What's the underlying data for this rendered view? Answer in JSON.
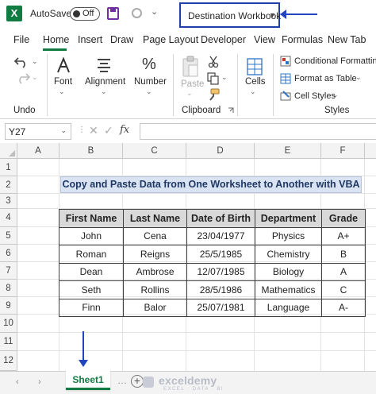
{
  "titlebar": {
    "logo_letter": "X",
    "autosave_label": "AutoSave",
    "autosave_state": "Off",
    "workbook_name": "Destination Workbook",
    "more_glyph": "⌄"
  },
  "menu_tabs": [
    "File",
    "Home",
    "Insert",
    "Draw",
    "Page Layout",
    "Developer",
    "View",
    "Formulas",
    "New Tab"
  ],
  "active_tab": "Home",
  "ribbon": {
    "undo_label": "Undo",
    "font_label": "Font",
    "alignment_label": "Alignment",
    "number_label": "Number",
    "paste_label": "Paste",
    "clipboard_label": "Clipboard",
    "cells_label": "Cells",
    "conditional_formatting": "Conditional Formatting",
    "format_as_table": "Format as Table",
    "cell_styles": "Cell Styles",
    "styles_label": "Styles",
    "dropdown_glyph": "⌄",
    "percent_glyph": "%"
  },
  "formula_bar": {
    "name_box": "Y27",
    "fx_label": "fx",
    "formula": ""
  },
  "grid": {
    "columns": [
      "A",
      "B",
      "C",
      "D",
      "E",
      "F"
    ],
    "rows": [
      "1",
      "2",
      "3",
      "4",
      "5",
      "6",
      "7",
      "8",
      "9",
      "10",
      "11",
      "12"
    ],
    "title": "Copy and Paste Data from One Worksheet to Another with VBA",
    "table_headers": [
      "First Name",
      "Last Name",
      "Date of Birth",
      "Department",
      "Grade"
    ],
    "table_rows": [
      [
        "John",
        "Cena",
        "23/04/1977",
        "Physics",
        "A+"
      ],
      [
        "Roman",
        "Reigns",
        "25/5/1985",
        "Chemistry",
        "B"
      ],
      [
        "Dean",
        "Ambrose",
        "12/07/1985",
        "Biology",
        "A"
      ],
      [
        "Seth",
        "Rollins",
        "28/5/1986",
        "Mathematics",
        "C"
      ],
      [
        "Finn",
        "Balor",
        "25/07/1981",
        "Language",
        "A-"
      ]
    ]
  },
  "sheets": {
    "tabs": [
      "Sheet1"
    ],
    "add_glyph": "+",
    "nav_prev": "‹",
    "nav_next": "›",
    "ellipsis": "…"
  },
  "watermark": {
    "name": "exceldemy",
    "tagline": "EXCEL · DATA · BI"
  },
  "colors": {
    "excel_green": "#107c41",
    "annotation_blue": "#2144c2",
    "title_fill": "#dae3f1",
    "header_fill": "#d9d9d9"
  }
}
